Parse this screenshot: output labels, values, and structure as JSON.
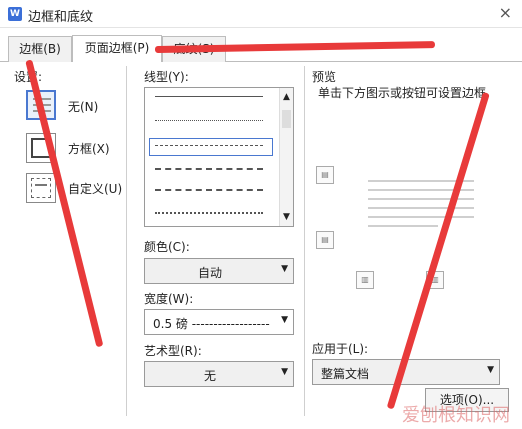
{
  "window": {
    "title": "边框和底纹",
    "close_icon": "×"
  },
  "tabs": [
    {
      "label": "边框(B)"
    },
    {
      "label": "页面边框(P)"
    },
    {
      "label": "底纹(S)"
    }
  ],
  "settings": {
    "heading": "设置:",
    "items": [
      {
        "label": "无(N)"
      },
      {
        "label": "方框(X)"
      },
      {
        "label": "自定义(U)"
      }
    ]
  },
  "line_style": {
    "heading": "线型(Y):"
  },
  "color": {
    "heading": "颜色(C):",
    "value": "自动"
  },
  "width": {
    "heading": "宽度(W):",
    "value": "0.5 磅 ------------------"
  },
  "art": {
    "heading": "艺术型(R):",
    "value": "无"
  },
  "preview": {
    "heading": "预览",
    "hint": "单击下方图示或按钮可设置边框"
  },
  "apply": {
    "heading": "应用于(L):",
    "value": "整篇文档"
  },
  "options_button": {
    "label": "选项(O)..."
  },
  "watermark": {
    "text": "爱刨根知识网"
  },
  "icons": {
    "app": "word-icon",
    "close": "close-icon"
  }
}
